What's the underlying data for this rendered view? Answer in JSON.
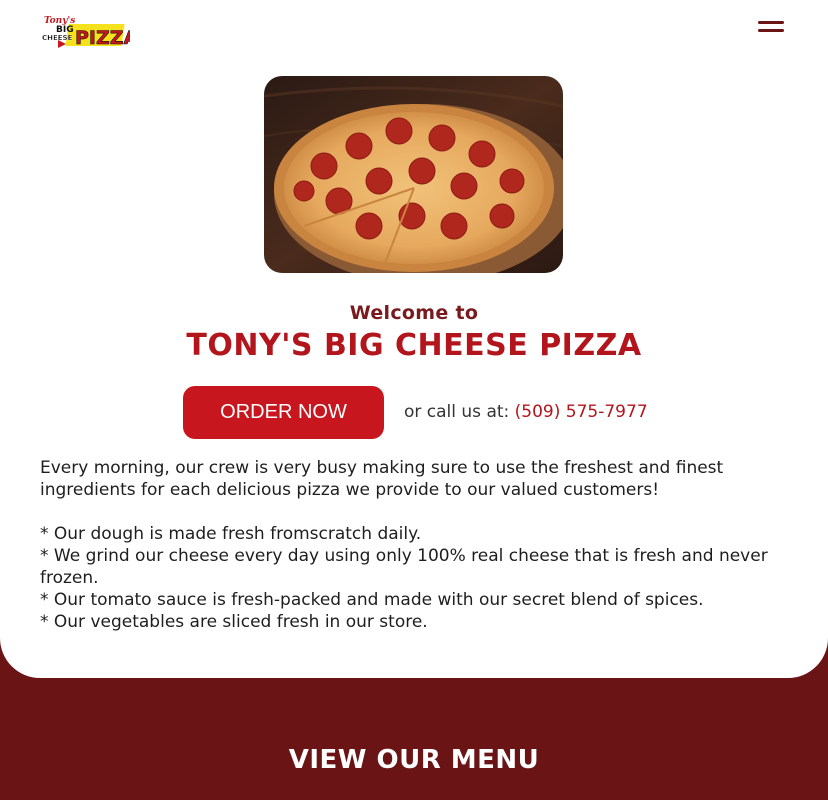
{
  "header": {
    "logo_text_top": "Tony's",
    "logo_text_big": "BIG",
    "logo_text_cheese": "CHEESE",
    "logo_text_pizza": "PIZZA",
    "menu_icon": "hamburger-menu-icon"
  },
  "hero": {
    "image_description_icon": "pizza-photo"
  },
  "welcome": {
    "line1": "Welcome to",
    "line2": "TONY'S BIG CHEESE PIZZA"
  },
  "order": {
    "button_label": "ORDER NOW",
    "call_prefix": "or call us at: ",
    "phone": "(509) 575-7977"
  },
  "content": {
    "intro": "Every morning, our crew is very busy making sure to use the freshest and finest ingredients for each delicious pizza we provide to our valued customers!",
    "bullets": [
      "* Our dough is made fresh fromscratch daily.",
      "* We grind our cheese every day using only 100% real cheese that is fresh and never frozen.",
      "* Our tomato sauce is fresh-packed and made with our secret blend of spices.",
      "* Our vegetables are sliced fresh in our store."
    ]
  },
  "footer": {
    "menu_heading": "VIEW OUR MENU"
  },
  "colors": {
    "brand_red": "#c8161e",
    "dark_maroon": "#6b1416",
    "welcome_text": "#7a1a1c"
  }
}
